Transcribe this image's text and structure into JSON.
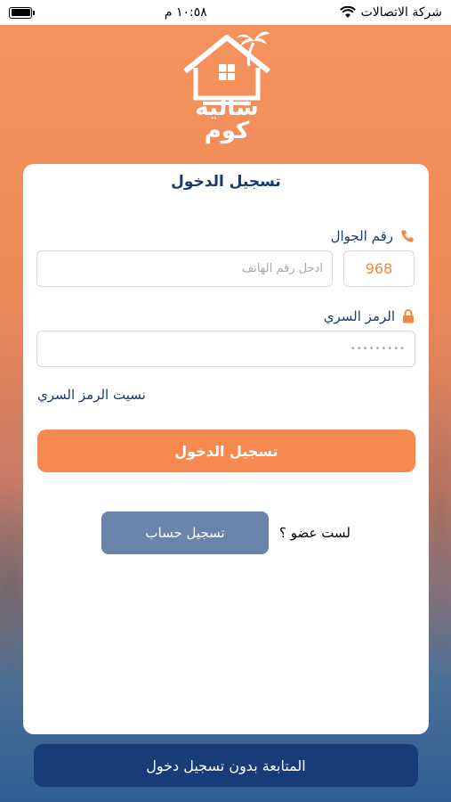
{
  "status_bar": {
    "carrier": "شركة الاتصالات",
    "time": "١٠:٥٨ م"
  },
  "logo": {
    "text_line1": "شاليه",
    "text_line2": "كوم"
  },
  "login": {
    "title": "تسجيل الدخول",
    "phone_label": "رقم الجوال",
    "country_code": "968",
    "phone_placeholder": "ادخل رقم الهاتف",
    "password_label": "الرمز السري",
    "password_placeholder": "•••••••••",
    "forgot_password": "نسيت الرمز السري",
    "login_button": "تسجيل الدخول",
    "not_member": "لست عضو ؟",
    "register_button": "تسجيل حساب"
  },
  "guest": {
    "continue_label": "المتابعة بدون تسجيل دخول"
  },
  "icons": {
    "phone": "phone-icon",
    "lock": "lock-icon",
    "wifi": "wifi-icon",
    "battery": "battery-icon"
  },
  "colors": {
    "accent_orange": "#f5894f",
    "navy": "#163d78",
    "register_blue": "#6a84ad"
  }
}
